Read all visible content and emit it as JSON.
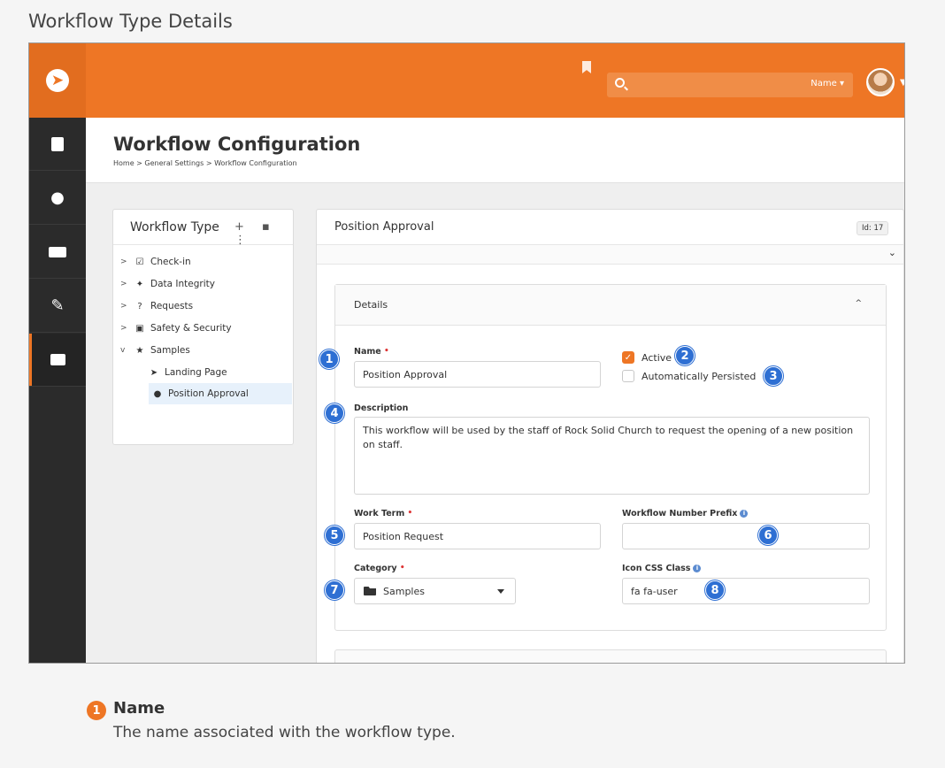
{
  "doc_title": "Workflow Type Details",
  "header": {
    "search_placeholder": "",
    "search_filter": "Name ▾"
  },
  "page": {
    "title": "Workflow Configuration",
    "breadcrumb": "Home > General Settings > Workflow Configuration"
  },
  "tree": {
    "title": "Workflow Type",
    "actions": "+ ▪ ⋮",
    "items": [
      {
        "label": "Check-in",
        "chevron": ">",
        "icon": "☑"
      },
      {
        "label": "Data Integrity",
        "chevron": ">",
        "icon": "✦"
      },
      {
        "label": "Requests",
        "chevron": ">",
        "icon": "?"
      },
      {
        "label": "Safety & Security",
        "chevron": ">",
        "icon": "▣"
      },
      {
        "label": "Samples",
        "chevron": "v",
        "icon": "★"
      },
      {
        "label": "Landing Page",
        "chevron": "",
        "icon": "➤"
      },
      {
        "label": "Position Approval",
        "chevron": "",
        "icon": "●"
      }
    ]
  },
  "detail": {
    "title": "Position Approval",
    "id_badge": "Id: 17",
    "section_title": "Details",
    "fields": {
      "name_label": "Name",
      "name_value": "Position Approval",
      "active_label": "Active",
      "persisted_label": "Automatically Persisted",
      "description_label": "Description",
      "description_value": "This workflow will be used by the staff of Rock Solid Church to request the opening of a new position on staff.",
      "work_term_label": "Work Term",
      "work_term_value": "Position Request",
      "prefix_label": "Workflow Number Prefix",
      "prefix_value": "",
      "category_label": "Category",
      "category_value": "Samples",
      "icon_css_label": "Icon CSS Class",
      "icon_css_value": "fa fa-user"
    },
    "required_mark": "•",
    "info_mark": "i",
    "active_checked": true,
    "persisted_checked": false
  },
  "callouts": [
    "1",
    "2",
    "3",
    "4",
    "5",
    "6",
    "7",
    "8"
  ],
  "legend": {
    "number": "1",
    "title": "Name",
    "description": "The name associated with the workflow type."
  },
  "colors": {
    "brand": "#ee7625",
    "callout": "#2e6fd3",
    "nav_bg": "#2b2b2b"
  }
}
